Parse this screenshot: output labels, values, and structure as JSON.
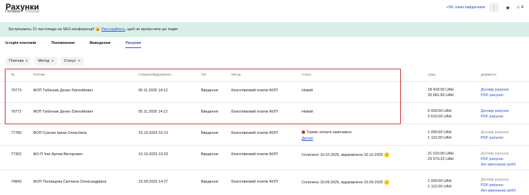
{
  "header": {
    "title": "Рахунки",
    "breadcrumb_home": "Головна",
    "breadcrumb_current": "Рахунки",
    "contractors": "+391 нових майданчиків",
    "notifications_count": "4"
  },
  "banner": {
    "text_before": "Зустріньмось 21 листопада на SEO-конференції! 🙀 ",
    "link": "Реєструйтесь",
    "text_after": ", щоб не пропустити цю подію"
  },
  "tabs": [
    "Історія платежів",
    "Поповнення",
    "Виведення",
    "Рахунки"
  ],
  "active_tab": "Рахунки",
  "filters": [
    "Платник",
    "Метод",
    "Статус"
  ],
  "table": {
    "headers": {
      "id": "№",
      "payer": "Платник",
      "created": "Створено/Відправлено",
      "type": "Тип",
      "method": "Метод",
      "status": "Статус",
      "amount": "Сума",
      "documents": "Документи"
    },
    "rows": [
      {
        "id": "79773",
        "payer": "ФОП Табачник Денис Євгенійович",
        "created": "05.11.2025 14:12",
        "type": "Введення",
        "method": "Безготівковий платіж ФОП",
        "status": "Новий",
        "amount1": "18 433.00 UAH",
        "amount2": "20 681.83 UAH",
        "doc1": "Договір рахунок",
        "doc2": "PDF рахунок"
      },
      {
        "id": "79772",
        "payer": "ФОП Табачник Денис Євгенійович",
        "created": "05.11.2025 14:12",
        "type": "Введення",
        "method": "Безготівковий платіж ФОП",
        "status": "Новий",
        "amount1": "5 000.00 UAH",
        "amount2": "5 610.00 UAH",
        "doc1": "Договір рахунок",
        "doc2": "PDF рахунок"
      },
      {
        "id": "77780",
        "payer": "ФОП Гузенко Ірина Олексіївна",
        "created": "15.10.2025 16:13",
        "type": "Введення",
        "method": "Безготівковий платіж ФОП",
        "status": "Термін оплати закінчився.",
        "status_link": "Деталі",
        "amount1": "1 000.00 UAH",
        "amount2": "1 122.00 UAH",
        "doc1": "Договір рахунок",
        "doc2": "PDF рахунок"
      },
      {
        "id": "77302",
        "payer": "ФО-П Чих Артем Вікторович",
        "created": "10.10.2025 10:23",
        "type": "Введення",
        "method": "Безготівковий платіж ФОП",
        "status": "Сплачено 10.10.2025, відправлено 10.10.2025",
        "amount1": "21 010.00 UAH",
        "amount2": "23 573.22 UAH",
        "doc1": "Договір рахунок",
        "doc2": "PDF рахунок",
        "doc3": "Акт виконаних робіт"
      },
      {
        "id": "74843",
        "payer": "ФОП Половцева Світлана Олександрівна",
        "created": "15.09.2025 14:27",
        "type": "Введення",
        "method": "Безготівковий платіж ФОП",
        "status": "Сплачено 15.09.2025, відправлено 15.09.2025",
        "amount1": "1 000.00 UAH",
        "amount2": "1 122.00 UAH",
        "doc1": "Договір рахунок",
        "doc2": "PDF рахунок",
        "doc3": "Акт виконаних робіт"
      }
    ]
  },
  "colors": {
    "accent": "#2a4bd8",
    "banner_bg": "#d9f0e7",
    "highlight": "#d32f2f"
  }
}
